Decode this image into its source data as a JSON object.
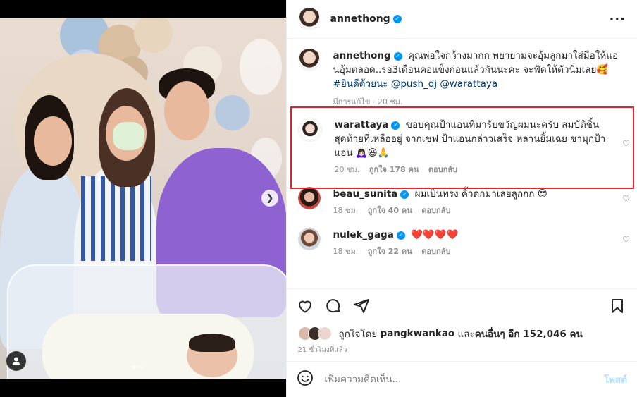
{
  "post": {
    "author": "annethong",
    "more_icon": "more-horizontal-icon"
  },
  "comments": [
    {
      "user": "annethong",
      "verified": true,
      "text": "คุณพ่อใจกว้างมากก พยายามจะอุ้มลูกมาใส่มือให้แอนอุ้มตลอด..รอ3เดือนคอแข็งก่อนแล้วกันนะคะ จะฟัดให้ตัวนิ่มเลย🥰",
      "hashtag": "#ยินดีด้วยนะ",
      "mentions": "@push_dj @warattaya",
      "meta": "มีการแก้ไข · 20 ชม."
    },
    {
      "user": "warattaya",
      "verified": true,
      "text": "ขอบคุณป้าแอนที่มารับขวัญผมนะครับ สมบัติชิ้นสุดท้ายที่เหลืออยู่ จากเชฟ ป้าแอนกล่าวเสร็จ หลานยิ้มเฉย ชามุกป้าแอน 🙇🏻‍♀️😆🙏",
      "time": "20 ชม.",
      "likes": "ถูกใจ 178 คน",
      "reply": "ตอบกลับ"
    },
    {
      "user": "beau_sunita",
      "verified": true,
      "text": "ผมเป็นทรง คิ้วดกมาเลยลูกกก 😍",
      "time": "18 ชม.",
      "likes": "ถูกใจ 40 คน",
      "reply": "ตอบกลับ"
    },
    {
      "user": "nulek_gaga",
      "verified": true,
      "text": "❤️❤️❤️❤️",
      "time": "18 ชม.",
      "likes": "ถูกใจ 22 คน",
      "reply": "ตอบกลับ"
    }
  ],
  "liked_by": {
    "prefix": "ถูกใจโดย",
    "user": "pangkwankao",
    "middle": "และ",
    "others": "คนอื่นๆ อีก 152,046 คน"
  },
  "posted_time": "21 ชั่วโมงที่แล้ว",
  "add_comment": {
    "placeholder": "เพิ่มความคิดเห็น...",
    "post_label": "โพสต์"
  },
  "colors": {
    "verified": "#0095f6",
    "highlight": "#e8202a",
    "post_button": "#b2dffc",
    "mention": "#00376b"
  }
}
